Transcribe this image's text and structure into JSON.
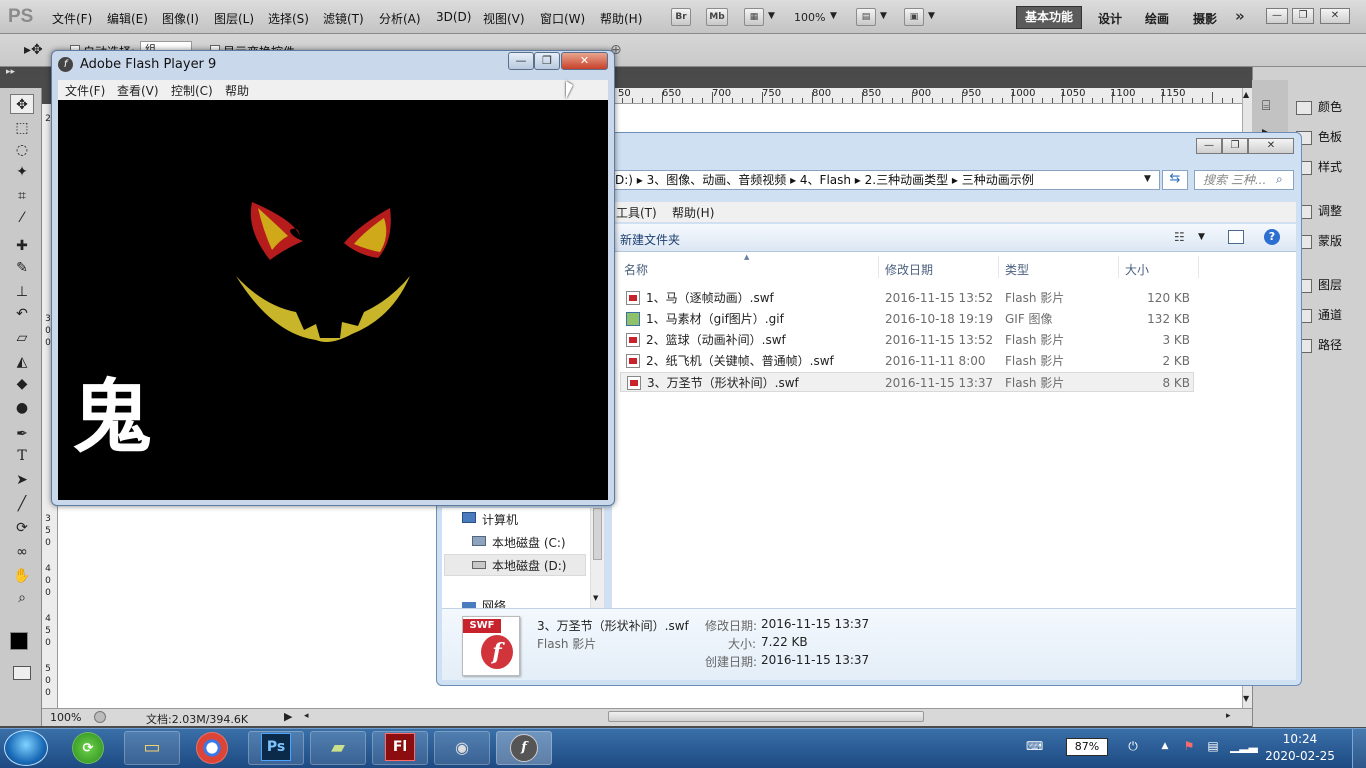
{
  "ps": {
    "logo": "PS",
    "menus": [
      "文件(F)",
      "编辑(E)",
      "图像(I)",
      "图层(L)",
      "选择(S)",
      "滤镜(T)",
      "分析(A)",
      "3D(D)",
      "视图(V)",
      "窗口(W)",
      "帮助(H)"
    ],
    "toolbar_icons": {
      "br": "Br",
      "mb": "Mb"
    },
    "zoom": "100%",
    "workspaces": {
      "basic": "基本功能",
      "design": "设计",
      "paint": "绘画",
      "photo": "摄影"
    },
    "options": {
      "auto_select": "自动选择:",
      "auto_select_value": "组",
      "show_transform": "显示变换控件"
    },
    "ruler_top": [
      "650",
      "700",
      "750",
      "800",
      "850",
      "900",
      "950",
      "1000",
      "1050",
      "1100",
      "1150"
    ],
    "ruler_partial": "50",
    "ruler_left": [
      "2",
      "5",
      "0",
      "3",
      "0",
      "0",
      "3",
      "5",
      "0",
      "4",
      "0",
      "0",
      "4",
      "5",
      "0",
      "5",
      "0",
      "0"
    ],
    "status": {
      "zoom": "100%",
      "doc": "文档:2.03M/394.6K"
    },
    "panels": [
      {
        "label": "颜色",
        "icon": "palette-icon"
      },
      {
        "label": "色板",
        "icon": "swatches-icon"
      },
      {
        "label": "样式",
        "icon": "styles-icon"
      },
      {
        "label": "调整",
        "icon": "adjust-icon"
      },
      {
        "label": "蒙版",
        "icon": "mask-icon"
      },
      {
        "label": "图层",
        "icon": "layers-icon"
      },
      {
        "label": "通道",
        "icon": "channels-icon"
      },
      {
        "label": "路径",
        "icon": "paths-icon"
      }
    ]
  },
  "explorer": {
    "address": "D:) ▸ 3、图像、动画、音频视频 ▸ 4、Flash ▸ 2.三种动画类型 ▸ 三种动画示例",
    "search_placeholder": "搜索 三种...",
    "menu": [
      "工具(T)",
      "帮助(H)"
    ],
    "new_folder": "新建文件夹",
    "columns": {
      "name": "名称",
      "date": "修改日期",
      "type": "类型",
      "size": "大小"
    },
    "files": [
      {
        "name": "1、马（逐帧动画）.swf",
        "date": "2016-11-15 13:52",
        "type": "Flash 影片",
        "size": "120 KB",
        "kind": "swf"
      },
      {
        "name": "1、马素材（gif图片）.gif",
        "date": "2016-10-18 19:19",
        "type": "GIF 图像",
        "size": "132 KB",
        "kind": "gif"
      },
      {
        "name": "2、篮球（动画补间）.swf",
        "date": "2016-11-15 13:52",
        "type": "Flash 影片",
        "size": "3 KB",
        "kind": "swf"
      },
      {
        "name": "2、纸飞机（关键帧、普通帧）.swf",
        "date": "2016-11-11 8:00",
        "type": "Flash 影片",
        "size": "2 KB",
        "kind": "swf"
      },
      {
        "name": "3、万圣节（形状补间）.swf",
        "date": "2016-11-15 13:37",
        "type": "Flash 影片",
        "size": "8 KB",
        "kind": "swf"
      }
    ],
    "nav": {
      "computer": "计算机",
      "drive_c": "本地磁盘 (C:)",
      "drive_d": "本地磁盘 (D:)",
      "network": "网络"
    },
    "details": {
      "filename": "3、万圣节（形状补间）.swf",
      "type": "Flash 影片",
      "mod_label": "修改日期:",
      "mod_value": "2016-11-15 13:37",
      "size_label": "大小:",
      "size_value": "7.22 KB",
      "created_label": "创建日期:",
      "created_value": "2016-11-15 13:37",
      "badge": "SWF",
      "glyph": "f"
    }
  },
  "flash": {
    "title": "Adobe Flash Player 9",
    "menus": [
      "文件(F)",
      "查看(V)",
      "控制(C)",
      "帮助"
    ],
    "ghost_char": "鬼",
    "colors": {
      "eye_outer": "#b71c1c",
      "eye_inner": "#d4c21a",
      "mouth": "#c9b52a",
      "stage": "#000000"
    }
  },
  "taskbar": {
    "ps_label": "Ps",
    "fl_label": "Fl",
    "battery": "87%",
    "battery_level": 0.87,
    "time": "10:24",
    "date": "2020-02-25"
  }
}
